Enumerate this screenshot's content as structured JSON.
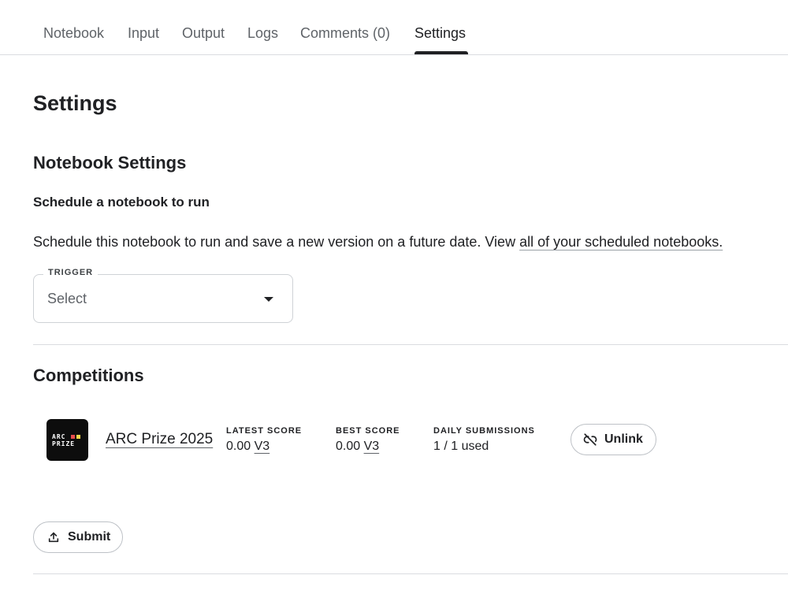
{
  "tabs": [
    {
      "label": "Notebook"
    },
    {
      "label": "Input"
    },
    {
      "label": "Output"
    },
    {
      "label": "Logs"
    },
    {
      "label": "Comments (0)"
    },
    {
      "label": "Settings",
      "active": true
    }
  ],
  "page_title": "Settings",
  "notebook_settings": {
    "title": "Notebook Settings",
    "schedule_title": "Schedule a notebook to run",
    "description": "Schedule this notebook to run and save a new version on a future date. View ",
    "description_link": "all of your scheduled notebooks.",
    "trigger": {
      "label": "TRIGGER",
      "value": "Select"
    }
  },
  "competitions": {
    "title": "Competitions",
    "items": [
      {
        "logo_text": [
          "ARC",
          "PRIZE"
        ],
        "name": "ARC Prize 2025",
        "latest_score_label": "LATEST SCORE",
        "latest_score": "0.00",
        "latest_version": "V3",
        "best_score_label": "BEST SCORE",
        "best_score": "0.00",
        "best_version": "V3",
        "daily_submissions_label": "DAILY SUBMISSIONS",
        "daily_submissions": "1 / 1 used",
        "unlink_label": "Unlink"
      }
    ]
  },
  "submit_label": "Submit",
  "colors": {
    "accent": "#202124",
    "muted": "#5f6368",
    "border": "#dadce0"
  }
}
